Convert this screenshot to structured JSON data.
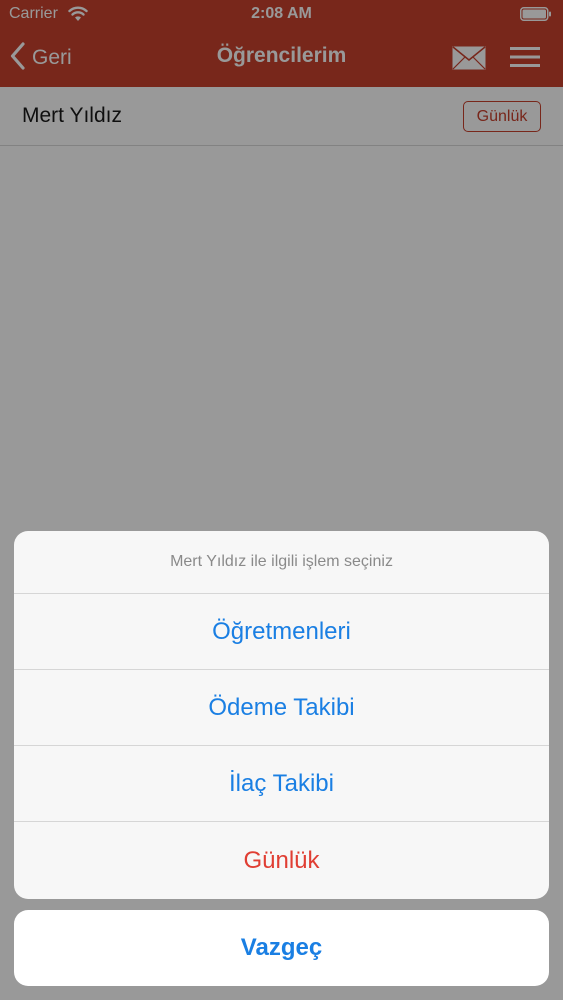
{
  "status_bar": {
    "carrier": "Carrier",
    "time": "2:08 AM"
  },
  "nav": {
    "back_label": "Geri",
    "title": "Öğrencilerim",
    "icons": [
      "chevron-left-icon",
      "mail-icon",
      "menu-icon"
    ]
  },
  "student": {
    "name": "Mert Yıldız",
    "gunluk_label": "Günlük"
  },
  "action_sheet": {
    "message": "Mert Yıldız ile ilgili işlem seçiniz",
    "actions": [
      {
        "label": "Öğretmenleri",
        "color": "#1a7fe3"
      },
      {
        "label": "Ödeme Takibi",
        "color": "#1a7fe3"
      },
      {
        "label": "İlaç Takibi",
        "color": "#1a7fe3"
      },
      {
        "label": "Günlük",
        "color": "#e03e33"
      }
    ],
    "cancel_label": "Vazgeç"
  },
  "colors": {
    "brand": "#c8412e",
    "action_blue": "#1a7fe3",
    "destructive_red": "#e03e33"
  }
}
